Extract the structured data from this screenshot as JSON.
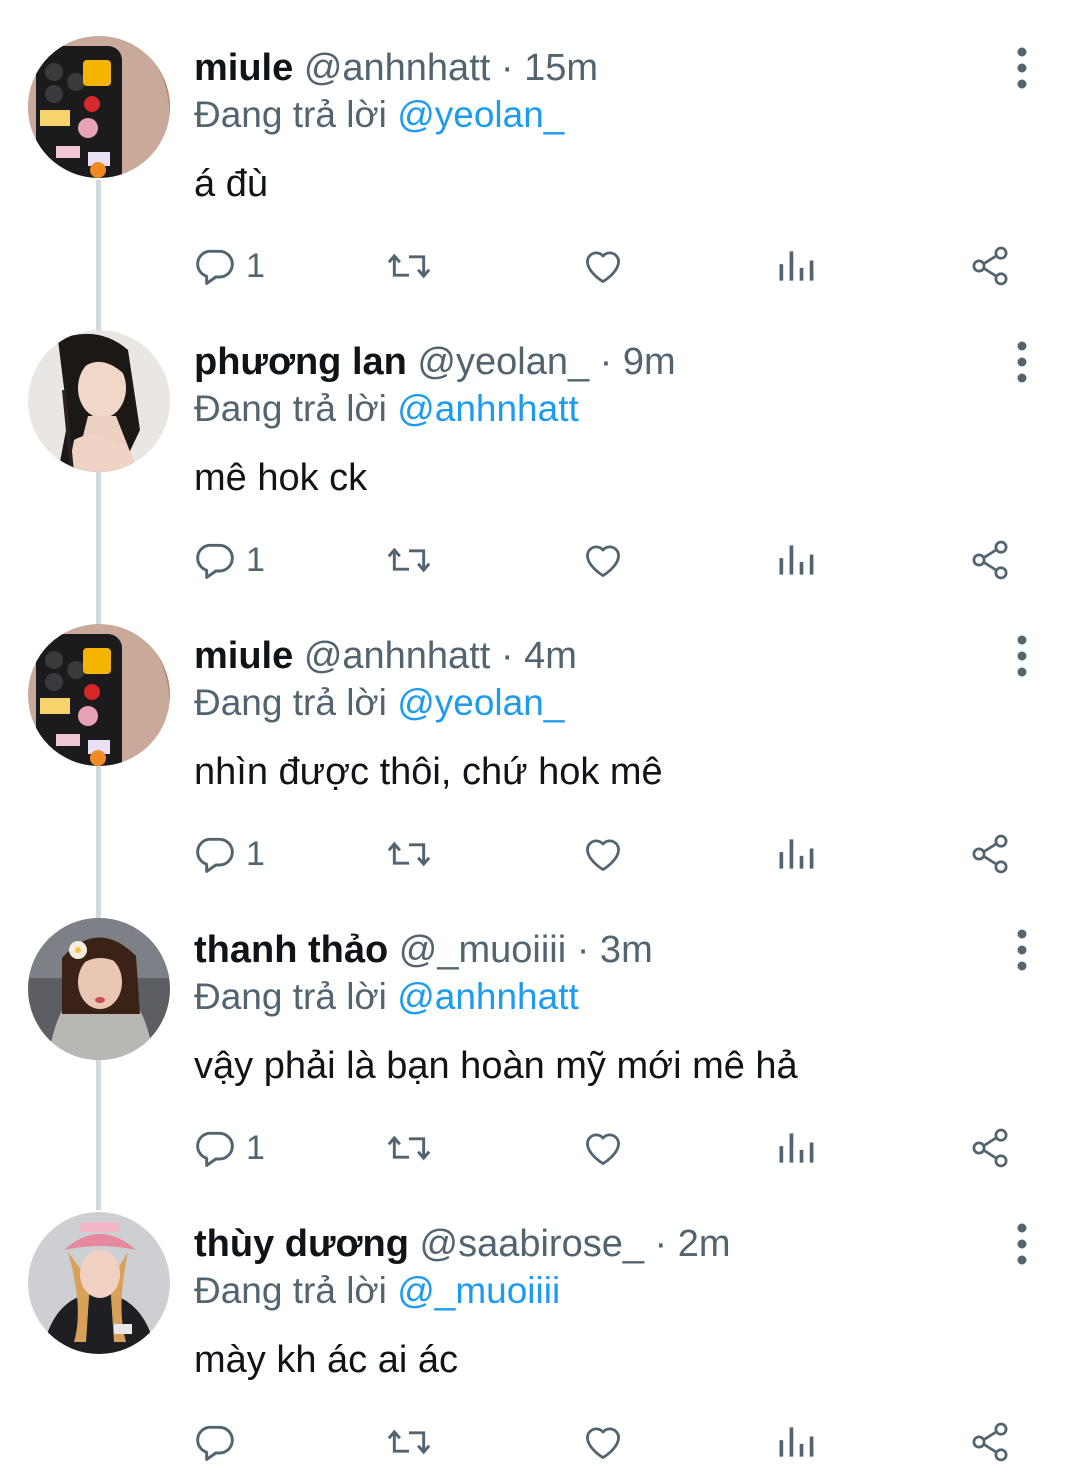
{
  "colors": {
    "accent": "#1d9bf0",
    "muted": "#536471",
    "text": "#0f1419",
    "thread_line": "#cfd9de"
  },
  "icons": {
    "reply": "reply-icon",
    "retweet": "retweet-icon",
    "like": "heart-icon",
    "views": "views-icon",
    "share": "share-icon",
    "more": "more-options-icon"
  },
  "tweets": [
    {
      "name": "miule",
      "meta": "@anhnhatt · 15m",
      "replying_prefix": "Đang trả lời ",
      "replying_to": "@yeolan_",
      "text": "á đù",
      "reply_count": "1"
    },
    {
      "name": "phương lan",
      "meta": "@yeolan_ · 9m",
      "replying_prefix": "Đang trả lời ",
      "replying_to": "@anhnhatt",
      "text": "mê hok ck",
      "reply_count": "1"
    },
    {
      "name": "miule",
      "meta": "@anhnhatt · 4m",
      "replying_prefix": "Đang trả lời ",
      "replying_to": "@yeolan_",
      "text": "nhìn được thôi, chứ hok mê",
      "reply_count": "1"
    },
    {
      "name": "thanh thảo",
      "meta": "@_muoiiii · 3m",
      "replying_prefix": "Đang trả lời ",
      "replying_to": "@anhnhatt",
      "text": "vậy phải là bạn hoàn mỹ mới mê hả",
      "reply_count": "1"
    },
    {
      "name": "thùy dương",
      "meta": "@saabirose_ · 2m",
      "replying_prefix": "Đang trả lời ",
      "replying_to": "@_muoiiii",
      "text": "mày kh ác ai ác",
      "reply_count": ""
    }
  ]
}
